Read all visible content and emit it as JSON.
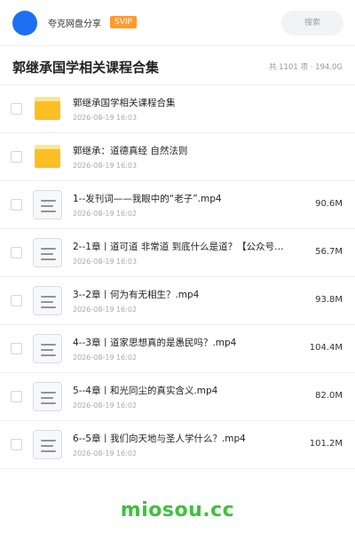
{
  "header": {
    "app_name": "夸克网盘分享",
    "badge": "SVIP",
    "search_placeholder": "搜索"
  },
  "folder": {
    "title": "郭继承国学相关课程合集",
    "summary": "共 1101 项 · 194.0G"
  },
  "items": [
    {
      "type": "folder",
      "name": "郭继承国学相关课程合集",
      "date": "2026-08-19 16:03",
      "size": ""
    },
    {
      "type": "folder",
      "name": "郭继承：道德真经 自然法则",
      "date": "2026-08-19 16:03",
      "size": ""
    },
    {
      "type": "file",
      "name": "1--发刊词——我眼中的“老子”.mp4",
      "date": "2026-08-19 16:02",
      "size": "90.6M"
    },
    {
      "type": "file",
      "name": "2--1章丨道可道 非常道 到底什么是道？【公众号…",
      "date": "2026-08-19 16:03",
      "size": "56.7M"
    },
    {
      "type": "file",
      "name": "3--2章丨何为有无相生？.mp4",
      "date": "2026-08-19 16:02",
      "size": "93.8M"
    },
    {
      "type": "file",
      "name": "4--3章丨道家思想真的是愚民吗？.mp4",
      "date": "2026-08-19 16:02",
      "size": "104.4M"
    },
    {
      "type": "file",
      "name": "5--4章丨和光同尘的真实含义.mp4",
      "date": "2026-08-19 16:02",
      "size": "82.0M"
    },
    {
      "type": "file",
      "name": "6--5章丨我们向天地与圣人学什么？.mp4",
      "date": "2026-08-19 16:02",
      "size": "101.2M"
    }
  ],
  "watermark": "miosou.cc",
  "colors": {
    "avatar": "#1e6ff1",
    "badge": "#ff9a2e",
    "folder": "#fbbf24",
    "watermark": "#3cc23c"
  },
  "icons": {
    "folder": "folder-icon",
    "file": "video-file-icon"
  }
}
